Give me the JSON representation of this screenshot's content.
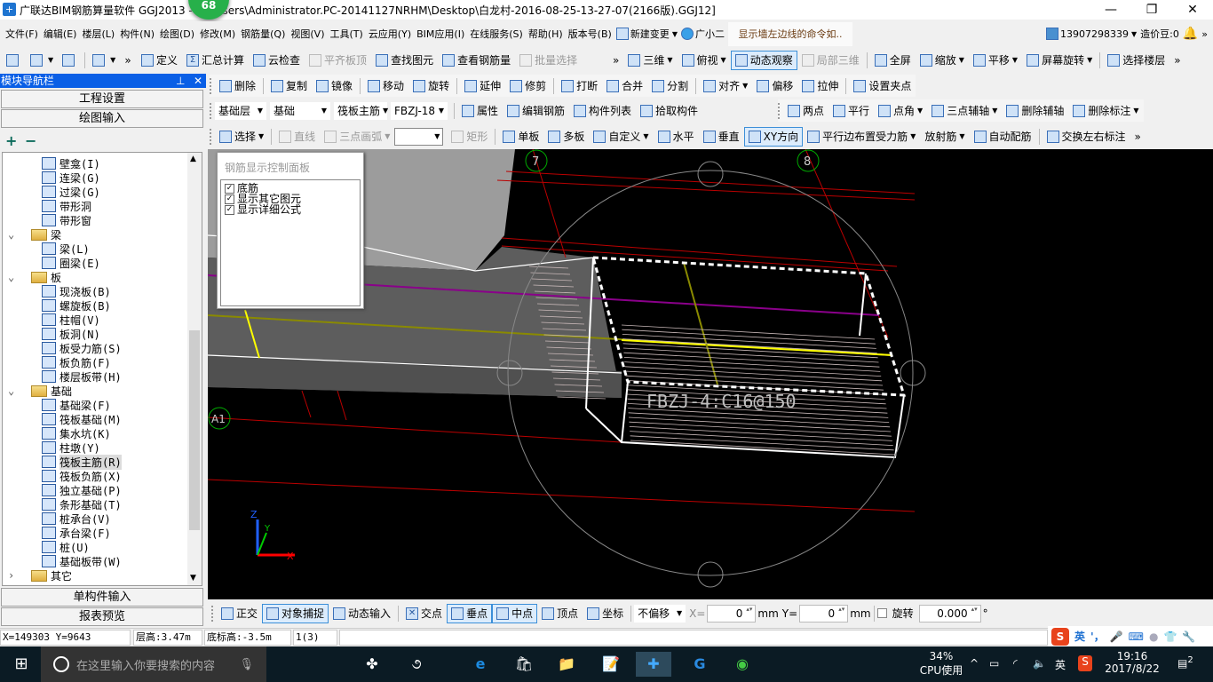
{
  "title": {
    "text": "广联达BIM钢筋算量软件 GGJ2013 - [C:\\Users\\Administrator.PC-20141127NRHM\\Desktop\\白龙村-2016-08-25-13-27-07(2166版).GGJ12]",
    "badge": "68",
    "logo": "+"
  },
  "menu": [
    "文件(F)",
    "编辑(E)",
    "楼层(L)",
    "构件(N)",
    "绘图(D)",
    "修改(M)",
    "钢筋量(Q)",
    "视图(V)",
    "工具(T)",
    "云应用(Y)",
    "BIM应用(I)",
    "在线服务(S)",
    "帮助(H)",
    "版本号(B)"
  ],
  "menu_extra": {
    "new_change": "新建变更",
    "assistant": "广小二",
    "tip": "显示墙左边线的命令如..",
    "account": "13907298339",
    "beans": "造价豆:0",
    "more": "»"
  },
  "toolbars": {
    "r1a": [
      {
        "icon": "new-file"
      },
      {
        "icon": "open-folder",
        "dd": 1
      },
      {
        "icon": "save"
      },
      {
        "sep": 1
      },
      {
        "icon": "undo",
        "dd": 1
      },
      {
        "label": "»"
      }
    ],
    "r1b": [
      {
        "label": "定义",
        "icon": "define"
      },
      {
        "label": "汇总计算",
        "icon": "sigma",
        "g": "Σ"
      },
      {
        "label": "云检查",
        "icon": "cloud-check"
      },
      {
        "label": "平齐板顶",
        "icon": "align-top",
        "dis": 1
      },
      {
        "label": "查找图元",
        "icon": "binoculars"
      },
      {
        "label": "查看钢筋量",
        "icon": "glasses"
      },
      {
        "label": "批量选择",
        "icon": "batch-select",
        "dis": 1
      }
    ],
    "r1c": [
      {
        "label": "»"
      },
      {
        "label": "三维",
        "icon": "cube-3d",
        "dd": 1
      },
      {
        "label": "俯视",
        "icon": "top-view",
        "dd": 1
      },
      {
        "label": "动态观察",
        "icon": "orbit",
        "act": 1
      },
      {
        "label": "局部三维",
        "icon": "partial-3d",
        "dis": 1
      },
      {
        "sep": 1
      },
      {
        "label": "全屏",
        "icon": "fullscreen"
      },
      {
        "label": "缩放",
        "icon": "zoom",
        "dd": 1
      },
      {
        "label": "平移",
        "icon": "pan-hand",
        "dd": 1
      },
      {
        "label": "屏幕旋转",
        "icon": "screen-rotate",
        "dd": 1
      },
      {
        "sep": 1
      },
      {
        "label": "选择楼层",
        "icon": "select-floor"
      },
      {
        "label": "»"
      }
    ],
    "ra": [
      {
        "label": "删除",
        "icon": "delete"
      },
      {
        "sep": 1
      },
      {
        "label": "复制",
        "icon": "copy"
      },
      {
        "label": "镜像",
        "icon": "mirror"
      },
      {
        "sep": 1
      },
      {
        "label": "移动",
        "icon": "move"
      },
      {
        "label": "旋转",
        "icon": "rotate"
      },
      {
        "sep": 1
      },
      {
        "label": "延伸",
        "icon": "extend"
      },
      {
        "label": "修剪",
        "icon": "trim"
      },
      {
        "sep": 1
      },
      {
        "label": "打断",
        "icon": "break"
      },
      {
        "label": "合并",
        "icon": "merge"
      },
      {
        "label": "分割",
        "icon": "split"
      },
      {
        "sep": 1
      },
      {
        "label": "对齐",
        "icon": "align",
        "dd": 1
      },
      {
        "label": "偏移",
        "icon": "offset"
      },
      {
        "label": "拉伸",
        "icon": "stretch"
      },
      {
        "sep": 1
      },
      {
        "label": "设置夹点",
        "icon": "grip-point"
      }
    ],
    "rb": [
      {
        "label": "属性",
        "icon": "properties"
      },
      {
        "label": "编辑钢筋",
        "icon": "edit-rebar"
      },
      {
        "label": "构件列表",
        "icon": "component-list"
      },
      {
        "label": "拾取构件",
        "icon": "eyedropper"
      }
    ],
    "rb2": [
      {
        "label": "两点",
        "icon": "two-point-axis"
      },
      {
        "label": "平行",
        "icon": "parallel-axis"
      },
      {
        "label": "点角",
        "icon": "point-angle",
        "dd": 1
      },
      {
        "label": "三点辅轴",
        "icon": "three-point-axis",
        "dd": 1
      },
      {
        "label": "删除辅轴",
        "icon": "delete-axis"
      },
      {
        "label": "删除标注",
        "icon": "delete-dimension",
        "dd": 1
      }
    ],
    "rc": [
      {
        "label": "选择",
        "icon": "cursor",
        "dd": 1
      },
      {
        "sep": 1
      },
      {
        "label": "直线",
        "icon": "line",
        "dis": 1
      },
      {
        "label": "三点画弧",
        "icon": "arc",
        "dis": 1,
        "dd": 1
      }
    ],
    "rc2": [
      {
        "label": "矩形",
        "icon": "rectangle",
        "dis": 1
      },
      {
        "sep": 1
      },
      {
        "label": "单板",
        "icon": "single-slab"
      },
      {
        "label": "多板",
        "icon": "multi-slab"
      },
      {
        "label": "自定义",
        "icon": "custom",
        "dd": 1
      },
      {
        "label": "水平",
        "icon": "horizontal"
      },
      {
        "label": "垂直",
        "icon": "vertical"
      },
      {
        "label": "XY方向",
        "icon": "xy-direction",
        "act": 1
      },
      {
        "label": "平行边布置受力筋",
        "icon": "parallel-edge-rebar",
        "dd": 1
      },
      {
        "label": "放射筋",
        "dd": 1
      },
      {
        "label": "自动配筋",
        "icon": "auto-rebar"
      },
      {
        "sep": 1
      },
      {
        "label": "交换左右标注",
        "icon": "swap-labels"
      },
      {
        "label": "»"
      }
    ],
    "snap": [
      {
        "label": "正交",
        "icon": "ortho"
      },
      {
        "label": "对象捕捉",
        "icon": "object-snap",
        "act": 1
      },
      {
        "label": "动态输入",
        "icon": "dynamic-input"
      },
      {
        "sep": 1
      },
      {
        "label": "交点",
        "icon": "intersection",
        "g": "✕"
      },
      {
        "label": "垂点",
        "icon": "perpendicular",
        "act": 1
      },
      {
        "label": "中点",
        "icon": "midpoint",
        "act": 1
      },
      {
        "label": "顶点",
        "icon": "vertex"
      },
      {
        "label": "坐标",
        "icon": "coordinate"
      }
    ]
  },
  "selectors": {
    "floor": "基础层",
    "category": "基础",
    "type": "筏板主筋",
    "name": "FBZJ-18",
    "empty": ""
  },
  "nav": {
    "title": "模块导航栏",
    "pin": "ꟷ",
    "close": "✕",
    "project_settings": "工程设置",
    "drawing_input": "绘图输入",
    "single_input": "单构件输入",
    "report_preview": "报表预览",
    "expand_all": "+",
    "collapse_all": "−",
    "tree": [
      {
        "label": "壁龛(I)",
        "lvl": 2
      },
      {
        "label": "连梁(G)",
        "lvl": 2
      },
      {
        "label": "过梁(G)",
        "lvl": 2
      },
      {
        "label": "带形洞",
        "lvl": 2
      },
      {
        "label": "带形窗",
        "lvl": 2
      },
      {
        "label": "梁",
        "lvl": 1,
        "folder": 1,
        "open": 1
      },
      {
        "label": "梁(L)",
        "lvl": 2
      },
      {
        "label": "圈梁(E)",
        "lvl": 2
      },
      {
        "label": "板",
        "lvl": 1,
        "folder": 1,
        "open": 1
      },
      {
        "label": "现浇板(B)",
        "lvl": 2
      },
      {
        "label": "螺旋板(B)",
        "lvl": 2
      },
      {
        "label": "柱帽(V)",
        "lvl": 2
      },
      {
        "label": "板洞(N)",
        "lvl": 2
      },
      {
        "label": "板受力筋(S)",
        "lvl": 2
      },
      {
        "label": "板负筋(F)",
        "lvl": 2
      },
      {
        "label": "楼层板带(H)",
        "lvl": 2
      },
      {
        "label": "基础",
        "lvl": 1,
        "folder": 1,
        "open": 1
      },
      {
        "label": "基础梁(F)",
        "lvl": 2
      },
      {
        "label": "筏板基础(M)",
        "lvl": 2
      },
      {
        "label": "集水坑(K)",
        "lvl": 2
      },
      {
        "label": "柱墩(Y)",
        "lvl": 2
      },
      {
        "label": "筏板主筋(R)",
        "lvl": 2,
        "selected": 1
      },
      {
        "label": "筏板负筋(X)",
        "lvl": 2
      },
      {
        "label": "独立基础(P)",
        "lvl": 2
      },
      {
        "label": "条形基础(T)",
        "lvl": 2
      },
      {
        "label": "桩承台(V)",
        "lvl": 2
      },
      {
        "label": "承台梁(F)",
        "lvl": 2
      },
      {
        "label": "桩(U)",
        "lvl": 2
      },
      {
        "label": "基础板带(W)",
        "lvl": 2
      },
      {
        "label": "其它",
        "lvl": 1,
        "folder": 1,
        "open": 0
      }
    ]
  },
  "panel": {
    "title": "钢筋显示控制面板",
    "options": [
      {
        "label": "底筋",
        "checked": true
      },
      {
        "label": "显示其它图元",
        "checked": true
      },
      {
        "label": "显示详细公式",
        "checked": true
      }
    ]
  },
  "viewport": {
    "rebar_label": "FBZJ-4:C16@150",
    "axes": [
      "7",
      "8",
      "A1"
    ],
    "triad": {
      "x": "X",
      "y": "Y",
      "z": "Z"
    }
  },
  "snap": {
    "offset": "不偏移",
    "x_label": "X=",
    "x_value": "0",
    "y_label": "Y=",
    "y_value": "0",
    "unit": "mm",
    "rotate_label": "旋转",
    "rotate_value": "0.000",
    "degree": "°"
  },
  "status": {
    "coords": "X=149303 Y=9643",
    "floor_height": "层高:3.47m",
    "base_elev": "底标高:-3.5m",
    "count": "1(3)"
  },
  "ime": {
    "logo": "S",
    "lang": "英",
    "punct": "'，"
  },
  "taskbar": {
    "search_placeholder": "在这里输入你要搜索的内容",
    "cpu": "34%",
    "cpu_label": "CPU使用",
    "lang": "英",
    "time": "19:16",
    "date": "2017/8/22",
    "notifications": "2"
  }
}
